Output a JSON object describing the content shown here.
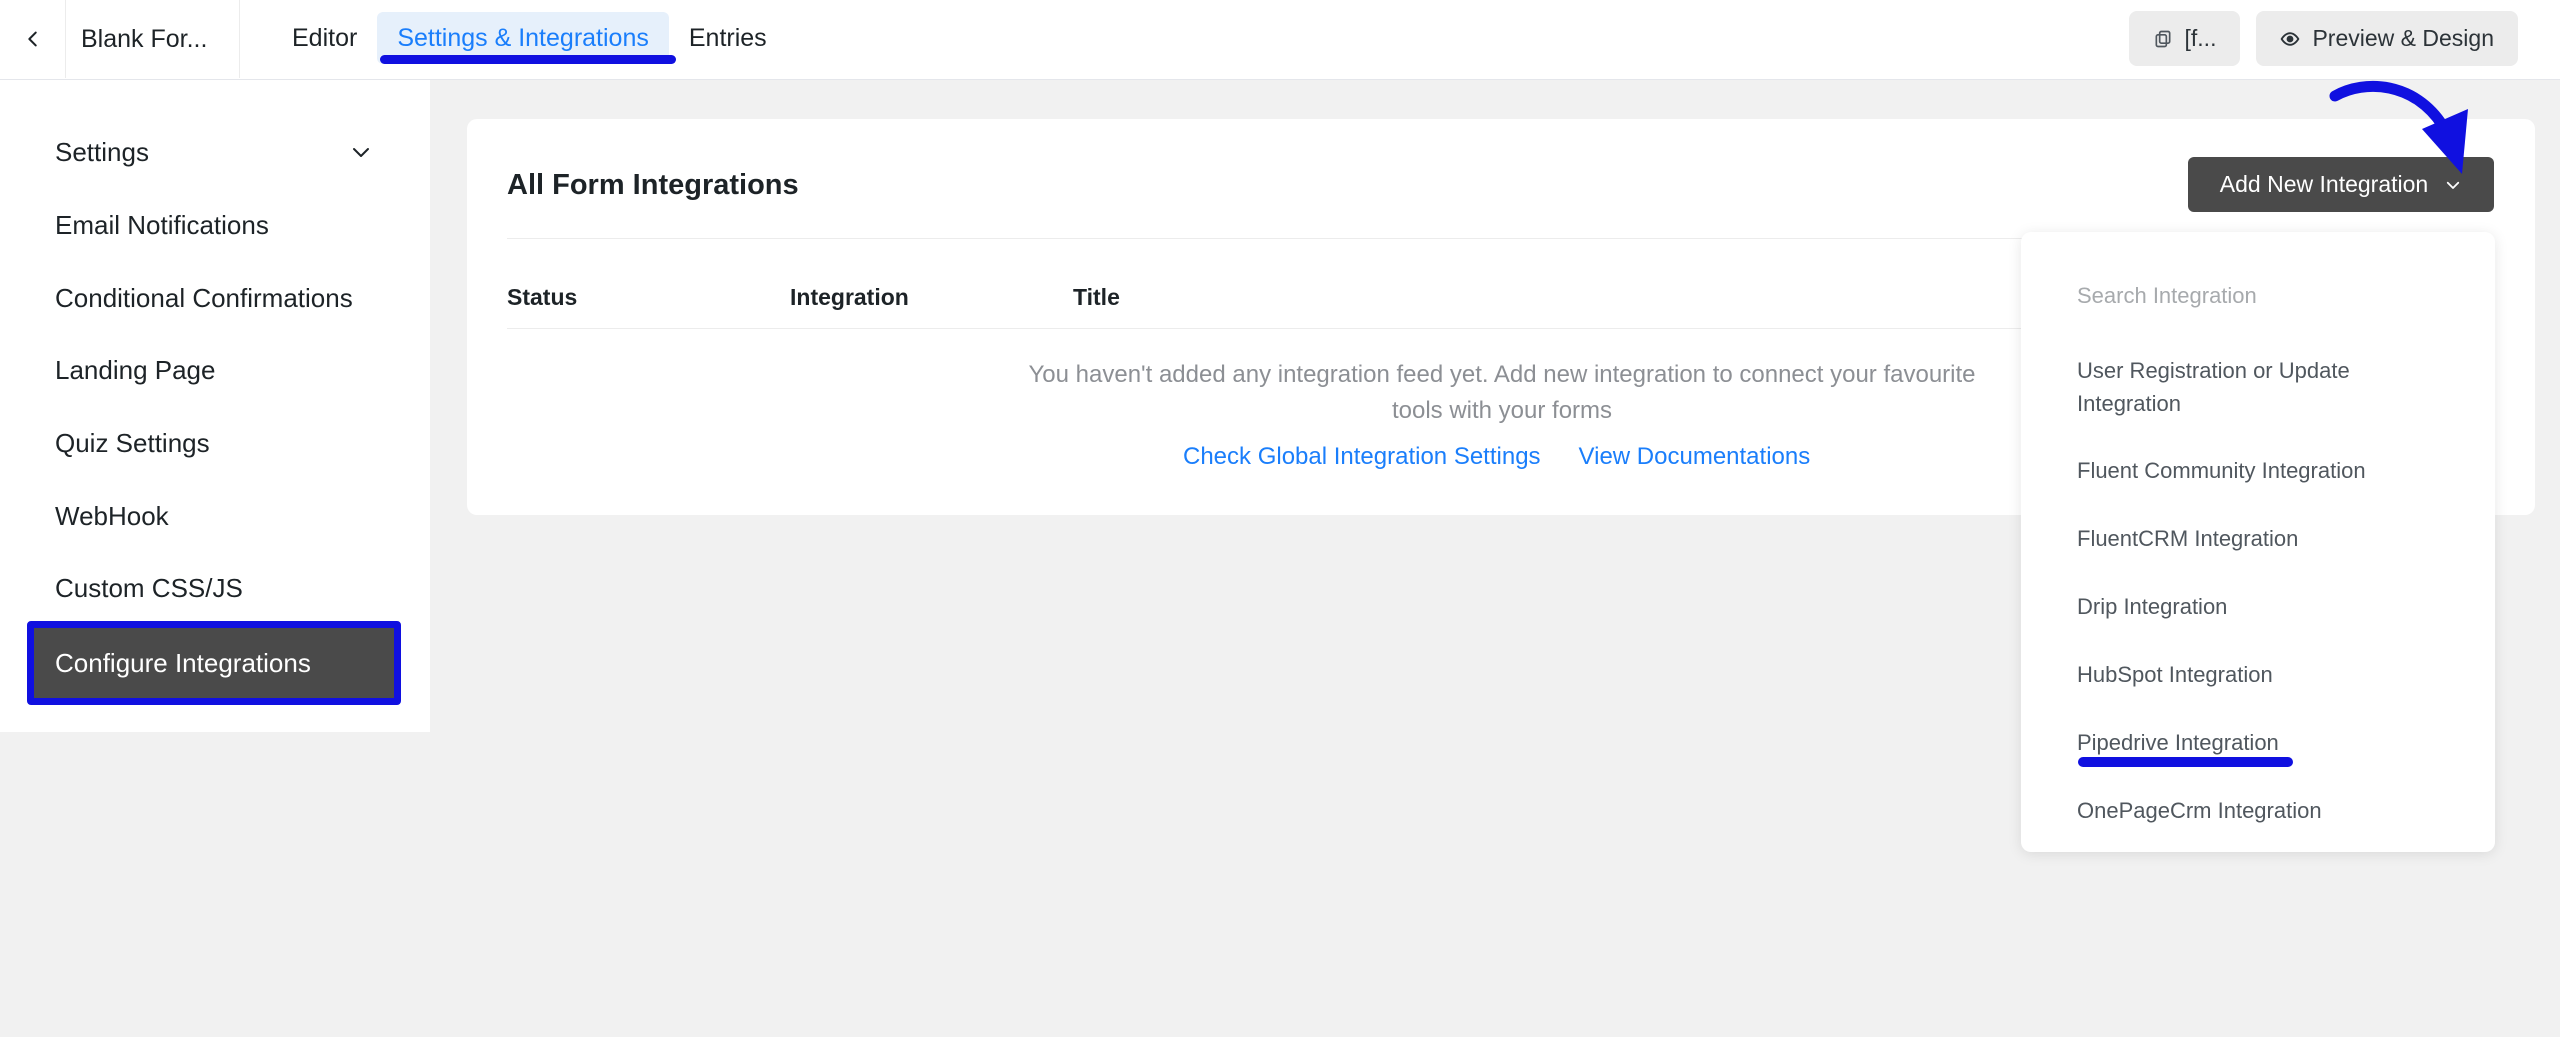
{
  "header": {
    "form_name": "Blank For...",
    "tabs": [
      {
        "label": "Editor"
      },
      {
        "label": "Settings & Integrations"
      },
      {
        "label": "Entries"
      }
    ],
    "shortcode_label": "[f...",
    "preview_label": "Preview & Design"
  },
  "sidebar": {
    "items": [
      {
        "label": "Settings"
      },
      {
        "label": "Email Notifications"
      },
      {
        "label": "Conditional Confirmations"
      },
      {
        "label": "Landing Page"
      },
      {
        "label": "Quiz Settings"
      },
      {
        "label": "WebHook"
      },
      {
        "label": "Custom CSS/JS"
      },
      {
        "label": "Configure Integrations"
      }
    ],
    "active_item": "Configure Integrations"
  },
  "main": {
    "title": "All Form Integrations",
    "add_button_label": "Add New Integration",
    "table": {
      "columns": [
        "Status",
        "Integration",
        "Title"
      ],
      "rows": []
    },
    "empty_message": "You haven't added any integration feed yet. Add new integration to connect your favourite tools with your forms",
    "links": {
      "global_settings": "Check Global Integration Settings",
      "docs": "View Documentations"
    }
  },
  "dropdown": {
    "search_placeholder": "Search Integration",
    "items": [
      {
        "label": "User Registration or Update Integration"
      },
      {
        "label": "Fluent Community Integration"
      },
      {
        "label": "FluentCRM Integration"
      },
      {
        "label": "Drip Integration"
      },
      {
        "label": "HubSpot Integration"
      },
      {
        "label": "Pipedrive Integration"
      },
      {
        "label": "OnePageCrm Integration"
      }
    ]
  },
  "colors": {
    "accent_blue": "#1a7efb",
    "annotation_blue": "#1010e0",
    "dark_button": "#4a4a4a",
    "page_bg": "#f1f1f1"
  }
}
